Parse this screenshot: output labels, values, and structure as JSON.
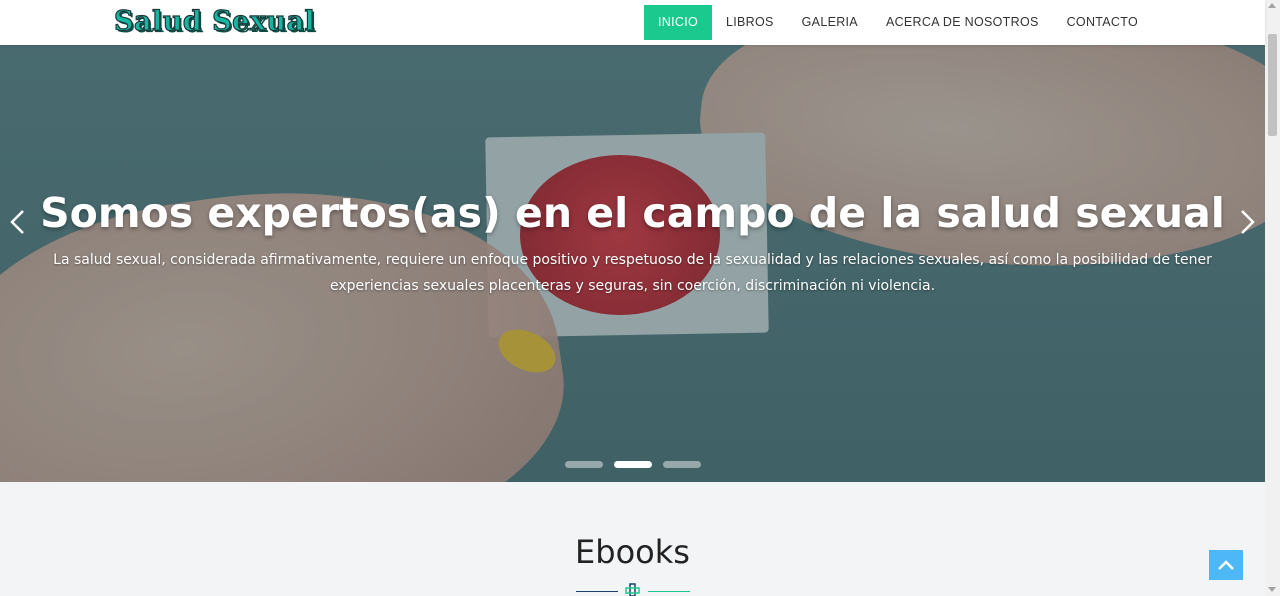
{
  "brand": {
    "logo_text": "Salud Sexual"
  },
  "nav": {
    "items": [
      {
        "label": "INICIO",
        "active": true
      },
      {
        "label": "LIBROS"
      },
      {
        "label": "GALERIA"
      },
      {
        "label": "ACERCA DE NOSOTROS"
      },
      {
        "label": "CONTACTO"
      }
    ]
  },
  "hero": {
    "title": "Somos expertos(as) en el campo de la salud sexual",
    "text": "La salud sexual, considerada afirmativamente, requiere un enfoque positivo y respetuoso de la sexualidad y las relaciones sexuales, así como la posibilidad de tener experiencias sexuales placenteras y seguras, sin coerción, discriminación ni violencia.",
    "prev_icon": "chevron-left-icon",
    "next_icon": "chevron-right-icon",
    "slides_total": 3,
    "active_slide": 2
  },
  "section": {
    "title": "Ebooks"
  },
  "colors": {
    "accent": "#1bc98e",
    "logo": "#16b6a3",
    "scroll_top": "#4db8f5"
  },
  "scroll_top_icon": "chevron-up-icon"
}
